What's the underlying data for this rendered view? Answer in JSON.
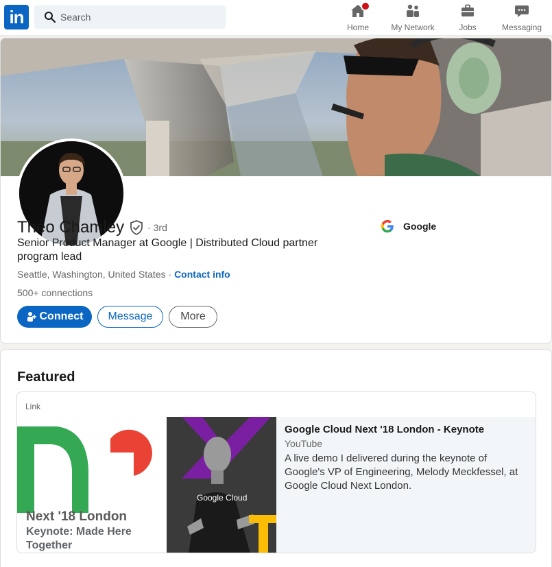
{
  "nav": {
    "logo_text": "in",
    "search_placeholder": "Search",
    "items": [
      {
        "label": "Home",
        "icon": "home-icon"
      },
      {
        "label": "My Network",
        "icon": "network-icon"
      },
      {
        "label": "Jobs",
        "icon": "briefcase-icon"
      },
      {
        "label": "Messaging",
        "icon": "messaging-icon"
      }
    ]
  },
  "profile": {
    "name": "Théo Chamley",
    "degree": "· 3rd",
    "headline": "Senior Product Manager at Google | Distributed Cloud partner program lead",
    "location": "Seattle, Washington, United States",
    "separator": " · ",
    "contact_label": "Contact info",
    "connections": "500+ connections",
    "actions": {
      "connect": "Connect",
      "message": "Message",
      "more": "More"
    },
    "company": "Google"
  },
  "featured": {
    "title": "Featured",
    "item": {
      "type": "Link",
      "thumb_line1": "Next '18 London",
      "thumb_line2": "Keynote: Made Here Together",
      "shirt_text": "Google Cloud",
      "title": "Google Cloud Next '18 London - Keynote",
      "source": "YouTube",
      "description": "A live demo I delivered during the keynote of Google's VP of Engineering, Melody Meckfessel, at Google Cloud Next London."
    }
  },
  "colors": {
    "brand": "#0a66c2",
    "badge": "#cc1016",
    "google_blue": "#4285f4",
    "google_red": "#ea4335",
    "google_yellow": "#fbbc05",
    "google_green": "#34a853",
    "purple": "#7b1fa2"
  }
}
